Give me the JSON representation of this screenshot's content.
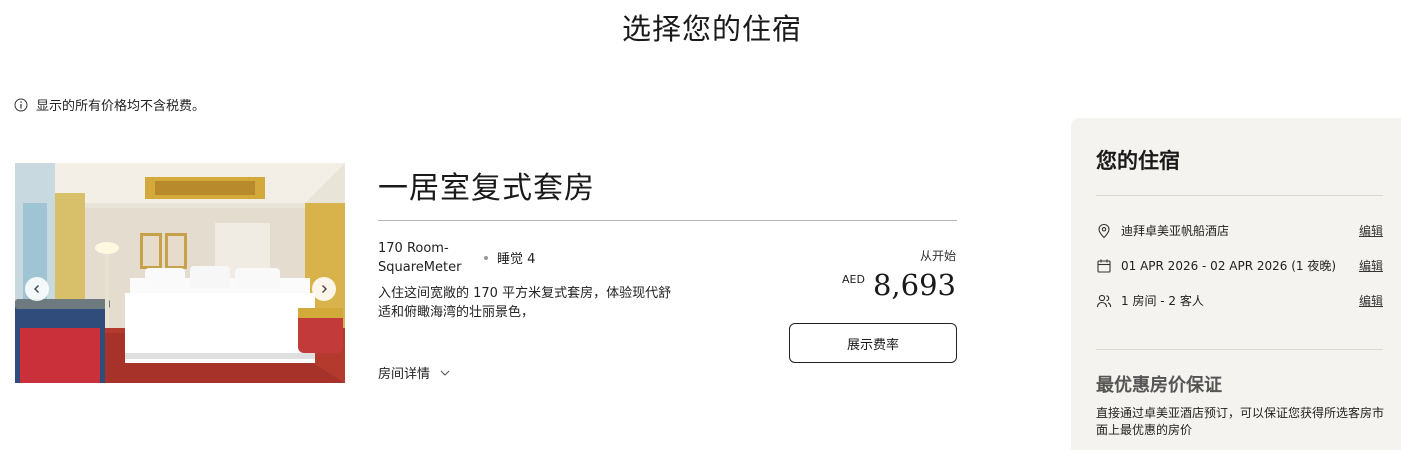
{
  "page": {
    "title": "选择您的住宿"
  },
  "notice": {
    "tax_text": "显示的所有价格均不含税费。"
  },
  "room": {
    "name": "一居室复式套房",
    "size_line1": "170 Room-",
    "size_line2": "SquareMeter",
    "sleeps": "睡觉 4",
    "description": "入住这间宽敞的 170 平方米复式套房，体验现代舒适和俯瞰海湾的壮丽景色，",
    "details_link": "房间详情",
    "price_from": "从开始",
    "currency": "AED",
    "price": "8,693",
    "show_rates_button": "展示费率"
  },
  "stay": {
    "title": "您的住宿",
    "hotel": "迪拜卓美亚帆船酒店",
    "dates": "01 APR 2026 - 02 APR 2026 (1 夜晚)",
    "guests": "1 房间 - 2 客人",
    "edit_label": "编辑",
    "guarantee_title": "最优惠房价保证",
    "guarantee_text": "直接通过卓美亚酒店预订，可以保证您获得所选客房市面上最优惠的房价"
  },
  "icons": {
    "info": "info-icon",
    "location": "location-pin-icon",
    "calendar": "calendar-icon",
    "guests": "people-icon",
    "chevron": "chevron-down-icon",
    "prev": "chevron-left-icon",
    "next": "chevron-right-icon"
  }
}
